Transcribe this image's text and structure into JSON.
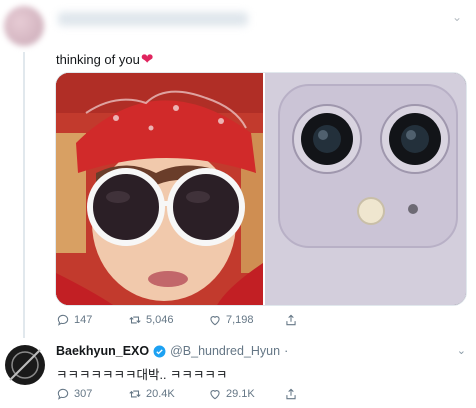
{
  "tweet": {
    "text": "thinking of you",
    "heart": "❤",
    "actions": {
      "replies": "147",
      "retweets": "5,046",
      "likes": "7,198"
    }
  },
  "reply": {
    "name": "Baekhyun_EXO",
    "handle": "@B_hundred_Hyun",
    "separator": "·",
    "text": "ㅋㅋㅋㅋㅋㅋㅋ대박.. ㅋㅋㅋㅋㅋ",
    "actions": {
      "replies": "307",
      "retweets": "20.4K",
      "likes": "29.1K"
    }
  },
  "colors": {
    "verified": "#1da1f2",
    "heart": "#e0245e",
    "muted": "#657786"
  }
}
